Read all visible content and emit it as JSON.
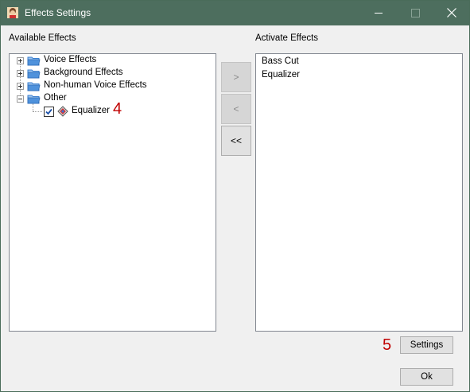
{
  "window": {
    "title": "Effects Settings",
    "controls": {
      "minimize": "minimize-icon",
      "maximize": "maximize-icon",
      "close": "close-icon"
    }
  },
  "available": {
    "label": "Available Effects",
    "tree": [
      {
        "label": "Voice Effects",
        "expanded": false
      },
      {
        "label": "Background Effects",
        "expanded": false
      },
      {
        "label": "Non-human Voice Effects",
        "expanded": false
      },
      {
        "label": "Other",
        "expanded": true,
        "children": [
          {
            "label": "Equalizer",
            "checked": true
          }
        ]
      }
    ]
  },
  "active": {
    "label": "Activate Effects",
    "items": [
      "Bass Cut",
      "Equalizer"
    ]
  },
  "move_buttons": {
    "add": ">",
    "remove": "<",
    "remove_all": "<<"
  },
  "buttons": {
    "settings": "Settings",
    "ok": "Ok"
  },
  "annotations": {
    "tree_marker": "4",
    "settings_marker": "5"
  },
  "colors": {
    "titlebar": "#4d6e5e",
    "annotation": "#c00000",
    "folder": "#3a7fd0"
  }
}
